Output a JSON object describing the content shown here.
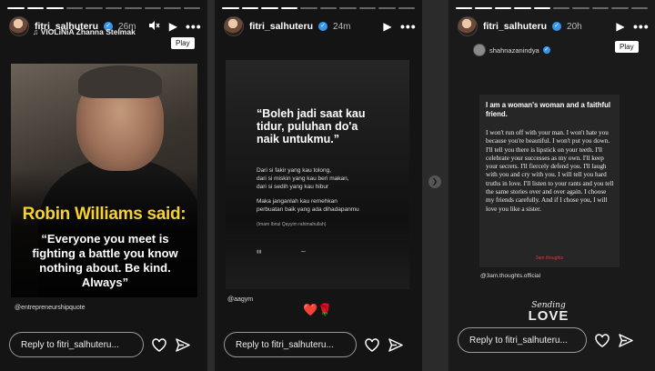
{
  "stories": [
    {
      "username": "fitri_salhuteru",
      "time": "26m",
      "music": "VIOLiNiA Zhanna Stelmak",
      "play_tooltip": "Play",
      "image": {
        "title": "Robin Williams said:",
        "quote": "“Everyone you meet is fighting a battle you know nothing about. Be kind. Always”"
      },
      "credit": "@entrepreneurshipquote",
      "reply_placeholder": "Reply to fitri_salhuteru..."
    },
    {
      "username": "fitri_salhuteru",
      "time": "24m",
      "image": {
        "headline": "“Boleh jadi saat kau tidur, puluhan do'a naik untukmu.”",
        "line1": "Dari si fakir yang kau tolong,",
        "line2": "dari si miskin yang kau beri makan,",
        "line3": "dari si sedih yang kau hibur",
        "line4": "Maka janganlah kau remehkan",
        "line5": "perbuatan baik yang ada dihadapanmu",
        "attribution": "(Imam Ibnul Qayyim rahimahullah)"
      },
      "credit": "@aagym",
      "stickers": "❤️🌹",
      "reply_placeholder": "Reply to fitri_salhuteru..."
    },
    {
      "username": "fitri_salhuteru",
      "time": "20h",
      "tagged_user": "shahnazanindya",
      "play_tooltip": "Play",
      "card": {
        "heading": "I am a woman's woman and a faithful friend.",
        "body": "I won't run off with your man. I won't hate you because you're beautiful. I won't put you down. I'll tell you there is lipstick on your teeth. I'll celebrate your successes as my own. I'll keep your secrets. I'll fiercely defend you. I'll laugh with you and cry with you. I will tell you hard truths in love. I'll listen to your rants and you tell the same stories over and over again. I choose my friends carefully. And if I chose you, I will love you like a sister.",
        "brand": "3am thoughts"
      },
      "credit": "@3am.thoughts.official",
      "gif_line1": "Sending",
      "gif_line2": "LOVE",
      "reply_placeholder": "Reply to fitri_salhuteru..."
    }
  ],
  "icons": {
    "play": "▶",
    "mute": "🔇",
    "more": "•••",
    "verified": "✓",
    "next": "❯"
  },
  "colors": {
    "quote_title": "#f6d12f",
    "verified": "#3797f0",
    "sticker_red": "#d9212c"
  }
}
